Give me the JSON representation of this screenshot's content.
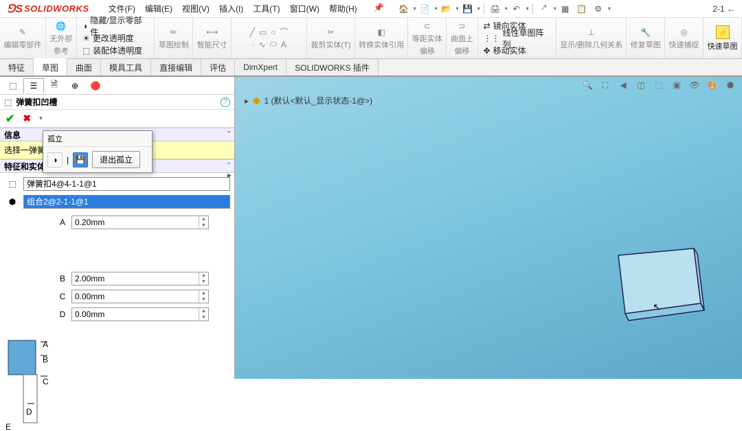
{
  "logo": "SOLIDWORKS",
  "menu": {
    "file": "文件(F)",
    "edit": "编辑(E)",
    "view": "视图(V)",
    "insert": "插入(I)",
    "tools": "工具(T)",
    "window": "窗口(W)",
    "help": "帮助(H)"
  },
  "status_right": "2-1 ←",
  "ribbon": {
    "g1a": "编辑零部件",
    "g1b_a": "无外部",
    "g1b_b": "参考",
    "g2a": "隐藏/显示零部件",
    "g2b": "更改透明度",
    "g2c": "装配体透明度",
    "g3": "草图绘制",
    "g4": "智能尺寸",
    "g5a": "裁剪实体(T)",
    "g5b": "转换实体引用",
    "g6a": "等距实体",
    "g6b": "偏移",
    "g7a": "曲面上",
    "g7b": "偏移",
    "g8a": "镜向实体",
    "g8b": "线性草图阵列",
    "g8c": "移动实体",
    "g9a": "显示/删除几何关系",
    "g10a": "修复草图",
    "g11a": "快速捕捉",
    "g12a": "快速草图"
  },
  "tabs": {
    "t1": "特征",
    "t2": "草图",
    "t3": "曲面",
    "t4": "模具工具",
    "t5": "直接编辑",
    "t6": "评估",
    "t7": "DimXpert",
    "t8": "SOLIDWORKS 插件"
  },
  "pm": {
    "title": "弹簧扣凹槽",
    "info_hdr": "信息",
    "info_msg": "选择一弹簧扣特征和一个面来生成凹槽",
    "sel_hdr": "特征和实体选择(B)",
    "sel1": "弹簧扣4@4-1-1@1",
    "sel2": "组合2@2-1-1@1",
    "dimA_label": "A",
    "dimA": "0.20mm",
    "dimB_label": "B",
    "dimB": "2.00mm",
    "dimC_label": "C",
    "dimC": "0.00mm",
    "dimD_label": "D",
    "dimD": "0.00mm"
  },
  "popup": {
    "title": "孤立",
    "btn": "退出孤立"
  },
  "tree": {
    "expand": "▸",
    "node": "1 (默认<默认_显示状态-1@>)"
  },
  "icons": {
    "pin": "📌",
    "home": "🏠",
    "new": "📄",
    "open": "📂",
    "save": "💾",
    "print": "🖨",
    "undo": "↶",
    "redo": "↷",
    "select": "🡕",
    "gear": "⚙",
    "help": "?",
    "ok": "✔",
    "cancel": "✖",
    "chev": "ˇ",
    "up": "▲",
    "dn": "▼",
    "tri": "▸",
    "eye": "👁",
    "cube": "⬚",
    "globe": "🌐"
  }
}
